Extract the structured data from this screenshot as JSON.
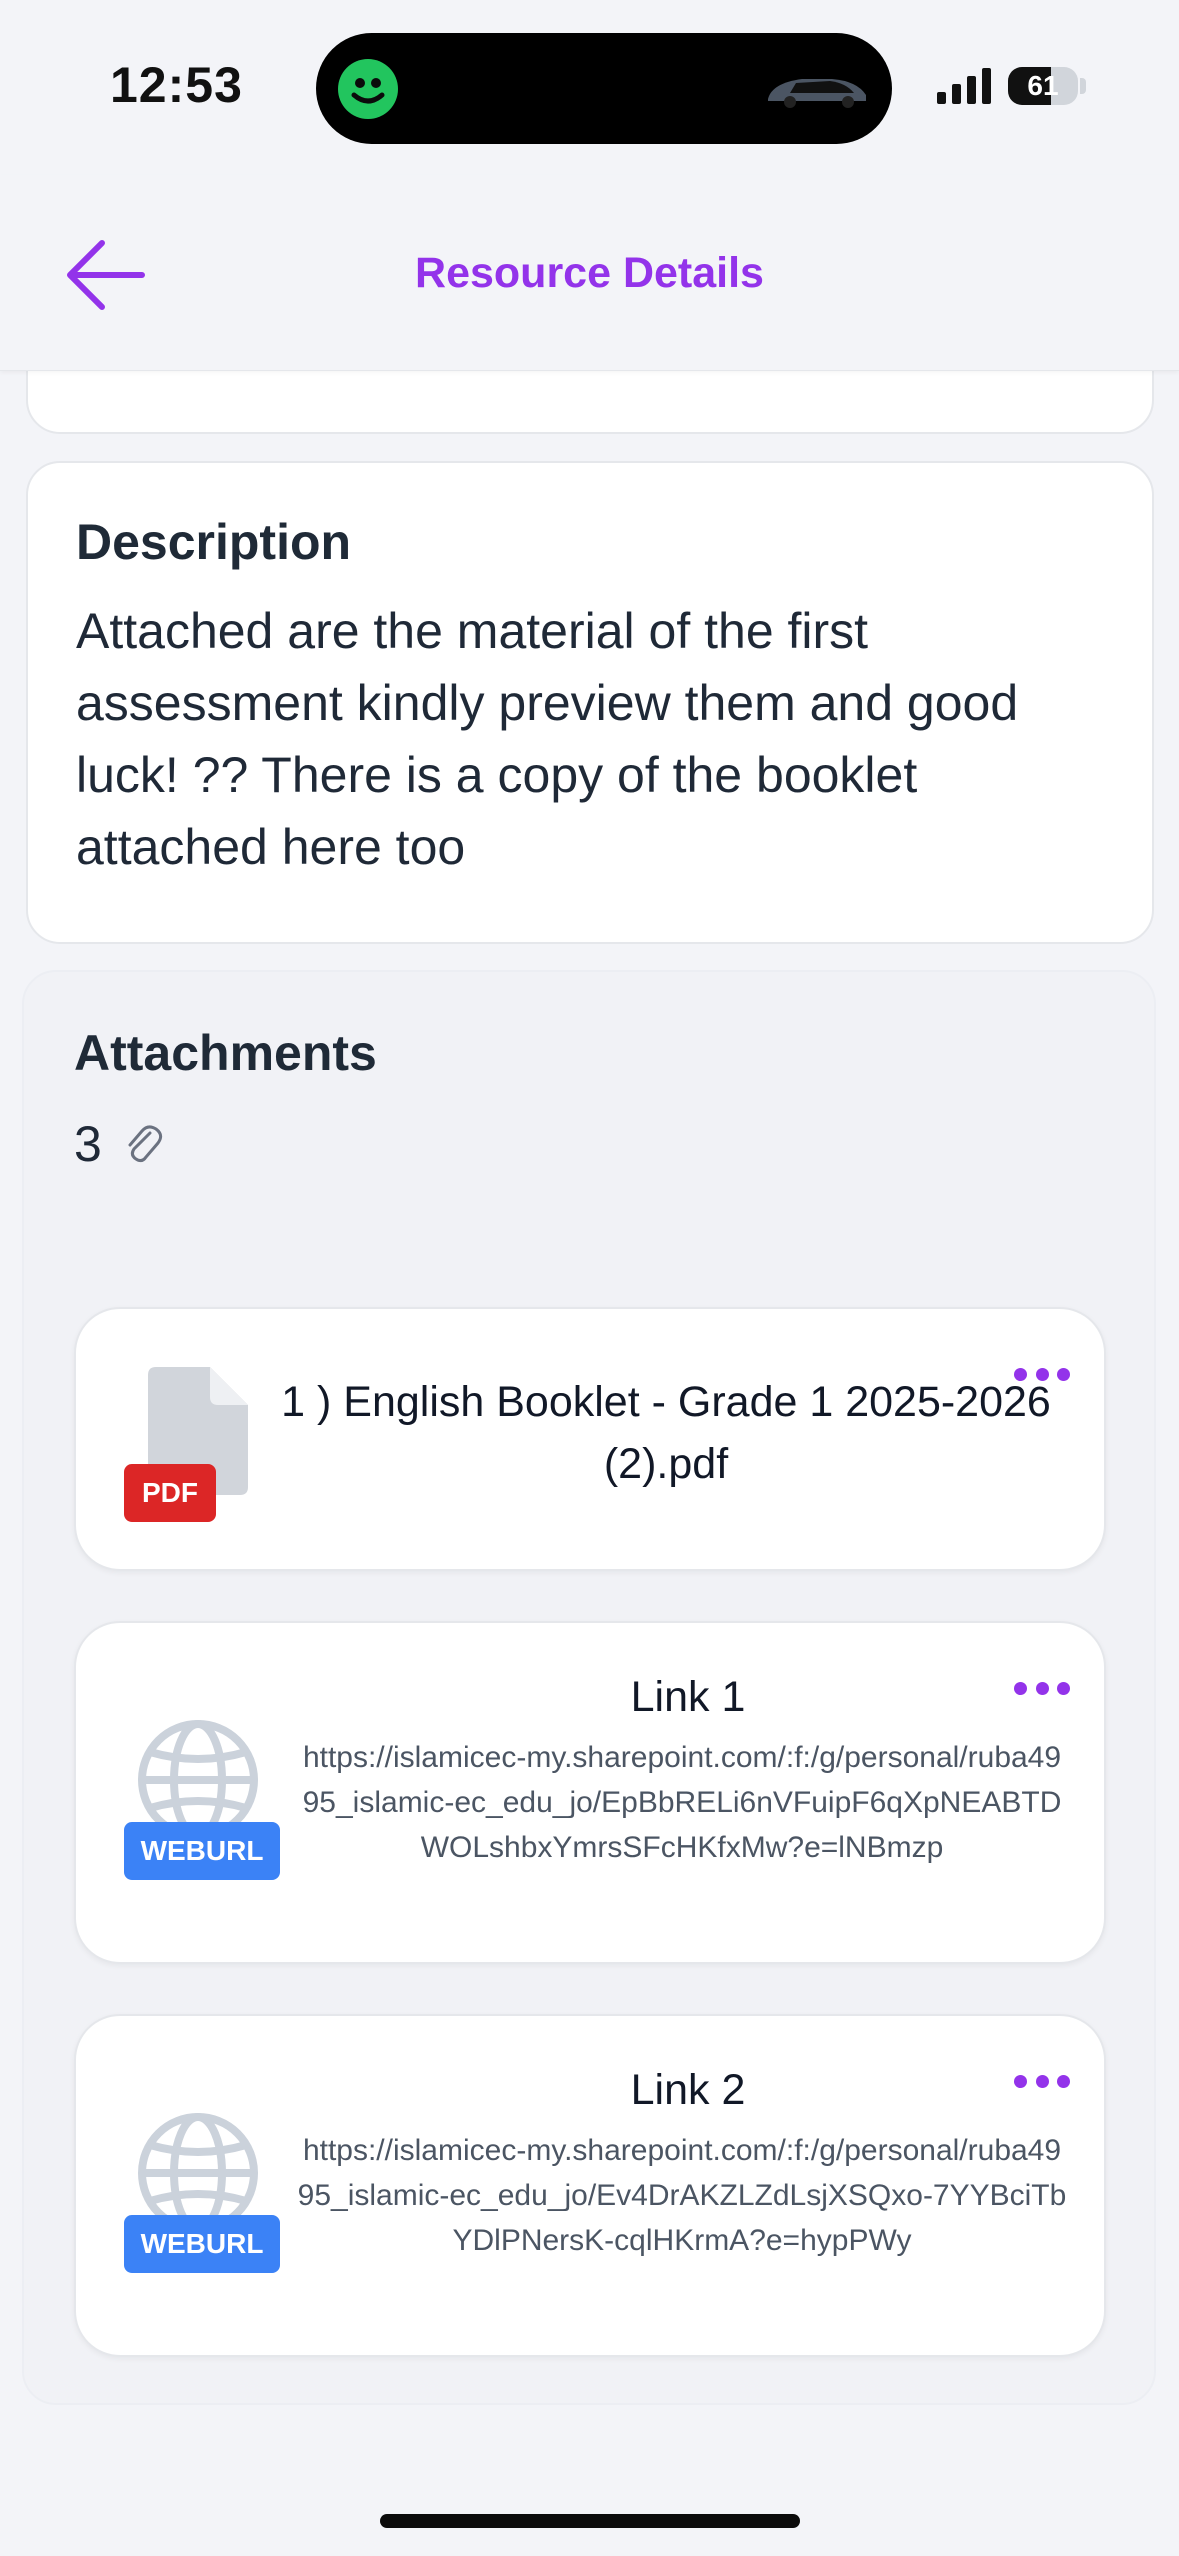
{
  "status_bar": {
    "time": "12:53",
    "battery": "61",
    "battery_level": 0.61
  },
  "header": {
    "title": "Resource Details",
    "back_icon": "arrow-left-icon"
  },
  "description": {
    "title": "Description",
    "text": "Attached are the material of the first assessment kindly preview them and good luck! ?? There is a copy of the booklet attached here too"
  },
  "attachments": {
    "title": "Attachments",
    "count": "3",
    "count_icon": "paperclip-icon",
    "items": [
      {
        "type_label": "PDF",
        "icon": "file-icon",
        "name": "1 ) English Booklet - Grade 1 2025-2026 (2).pdf"
      },
      {
        "type_label": "WEBURL",
        "icon": "globe-icon",
        "title": "Link 1",
        "url": "https://islamicec-my.sharepoint.com/:f:/g/personal/ruba4995_islamic-ec_edu_jo/EpBbRELi6nVFuipF6qXpNEABTDWOLshbxYmrsSFcHKfxMw?e=lNBmzp"
      },
      {
        "type_label": "WEBURL",
        "icon": "globe-icon",
        "title": "Link 2",
        "url": "https://islamicec-my.sharepoint.com/:f:/g/personal/ruba4995_islamic-ec_edu_jo/Ev4DrAKZLZdLsjXSQxo-7YYBciTbYDlPNersK-cqlHKrmA?e=hypPWy"
      }
    ]
  },
  "colors": {
    "accent": "#9333ea",
    "pdf": "#dc2626",
    "weburl": "#3b82f6"
  }
}
